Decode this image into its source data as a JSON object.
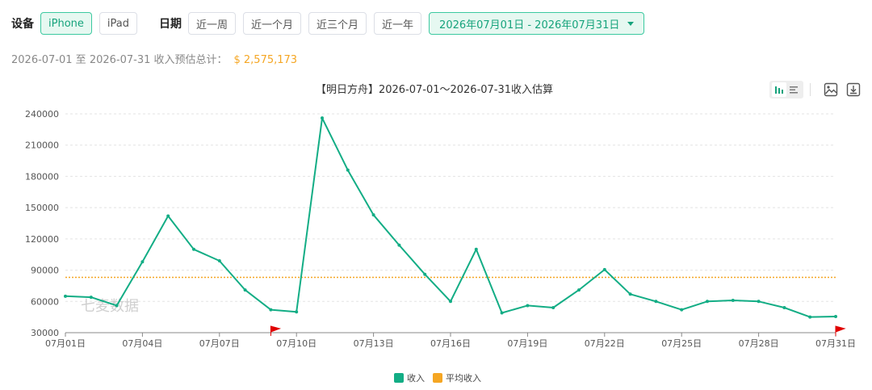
{
  "filters": {
    "device_label": "设备",
    "devices": [
      {
        "label": "iPhone",
        "active": true
      },
      {
        "label": "iPad",
        "active": false
      }
    ],
    "date_label": "日期",
    "ranges": [
      "近一周",
      "近一个月",
      "近三个月",
      "近一年"
    ],
    "date_range": "2026年07月01日 - 2026年07月31日"
  },
  "summary": {
    "text": "2026-07-01 至 2026-07-31 收入预估总计：",
    "total": "$ 2,575,173"
  },
  "toolbar_icons": [
    "bar-chart-icon",
    "list-icon",
    "image-download-icon",
    "download-icon"
  ],
  "watermark": "七麦数据",
  "colors": {
    "accent": "#16a37c",
    "series": "#13ad85",
    "average": "#f5a623",
    "flag": "#e00000"
  },
  "chart_data": {
    "type": "line",
    "title": "【明日方舟】2026-07-01～2026-07-31收入估算",
    "x": [
      "07月01日",
      "07月02日",
      "07月03日",
      "07月04日",
      "07月05日",
      "07月06日",
      "07月07日",
      "07月08日",
      "07月09日",
      "07月10日",
      "07月11日",
      "07月12日",
      "07月13日",
      "07月14日",
      "07月15日",
      "07月16日",
      "07月17日",
      "07月18日",
      "07月19日",
      "07月20日",
      "07月21日",
      "07月22日",
      "07月23日",
      "07月24日",
      "07月25日",
      "07月26日",
      "07月27日",
      "07月28日",
      "07月29日",
      "07月30日",
      "07月31日"
    ],
    "x_tick_labels": [
      "07月01日",
      "07月04日",
      "07月07日",
      "07月10日",
      "07月13日",
      "07月16日",
      "07月19日",
      "07月22日",
      "07月25日",
      "07月28日",
      "07月31日"
    ],
    "series": [
      {
        "name": "收入",
        "color": "#13ad85",
        "values": [
          65000,
          64000,
          56000,
          98000,
          142000,
          110000,
          99000,
          71000,
          52000,
          50000,
          236000,
          186000,
          143000,
          114000,
          86000,
          60000,
          110000,
          49000,
          56000,
          54000,
          71000,
          90500,
          67000,
          60000,
          52000,
          60000,
          61000,
          60000,
          54000,
          45000,
          45500
        ]
      },
      {
        "name": "平均收入",
        "color": "#f5a623",
        "average": 83070
      }
    ],
    "ylim": [
      30000,
      240000
    ],
    "y_ticks": [
      30000,
      60000,
      90000,
      120000,
      150000,
      180000,
      210000,
      240000
    ],
    "grid": true,
    "legend": "bottom",
    "flags_at": [
      "07月09日",
      "07月31日"
    ]
  }
}
